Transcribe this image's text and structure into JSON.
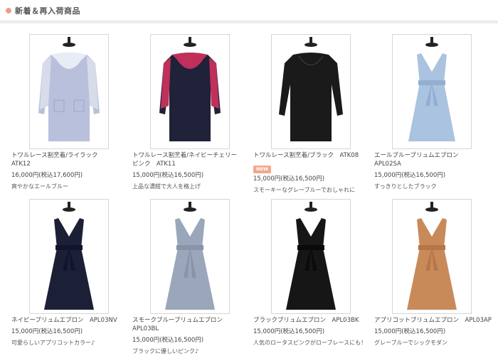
{
  "header": {
    "title": "新着＆再入荷商品"
  },
  "products": [
    {
      "name": "トワルレース割烹着/ライラック\nATK12",
      "price": "16,000円(税込17,600円)",
      "desc": "爽やかなエールブルー",
      "badge": ""
    },
    {
      "name": "トワルレース割烹着/ネイビーチェリー\nピンク　ATK11",
      "price": "15,000円(税込16,500円)",
      "desc": "上品な濃紺で大人を格上げ",
      "badge": ""
    },
    {
      "name": "トワルレース割烹着/ブラック　ATK08",
      "price": "15,000円(税込16,500円)",
      "desc": "スモーキーなグレーブルーでおしゃれに",
      "badge": "NEW"
    },
    {
      "name": "エールブルーブリュムエプロン\nAPL02SA",
      "price": "15,000円(税込16,500円)",
      "desc": "すっきりとしたブラック",
      "badge": ""
    },
    {
      "name": "ネイビーブリュムエプロン　APL03NV",
      "price": "15,000円(税込16,500円)",
      "desc": "可愛らしいアプリコットカラー♪",
      "badge": ""
    },
    {
      "name": "スモークブルーブリュムエプロン\nAPL03BL",
      "price": "15,000円(税込16,500円)",
      "desc": "ブラックに優しいピンク♪",
      "badge": ""
    },
    {
      "name": "ブラックブリュムエプロン　APL03BK",
      "price": "15,000円(税込16,500円)",
      "desc": "人気のロータスピンクがローブレースにも！",
      "badge": ""
    },
    {
      "name": "アプリコットブリュムエプロン　APL03AP",
      "price": "15,000円(税込16,500円)",
      "desc": "グレーブルーでシックモダン",
      "badge": ""
    }
  ],
  "colors": {
    "lilac": "#b8c0dc",
    "navy": "#1f2238",
    "cherry": "#c0305a",
    "black": "#1a1a1a",
    "sax": "#a9c3e0",
    "smoke": "#9aa6ba",
    "apricot": "#c98a5a"
  }
}
